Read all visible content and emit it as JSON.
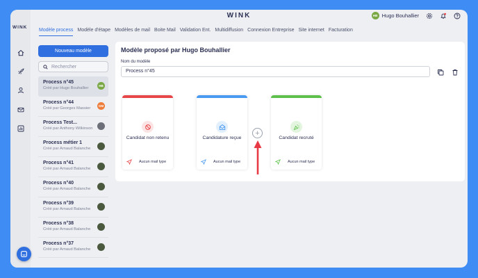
{
  "app": {
    "brand": "WINK",
    "rail_logo": "WINK"
  },
  "header": {
    "user_name": "Hugo Bouhallier",
    "user_initials": "HB",
    "icons": [
      "gear-icon",
      "bell-icon",
      "help-icon"
    ]
  },
  "tabs": [
    {
      "label": "Modèle process",
      "active": true
    },
    {
      "label": "Modèle d'étape"
    },
    {
      "label": "Modèles de mail"
    },
    {
      "label": "Boite Mail"
    },
    {
      "label": "Validation Ent."
    },
    {
      "label": "Multidiffusion"
    },
    {
      "label": "Connexion Entreprise"
    },
    {
      "label": "Site internet"
    },
    {
      "label": "Facturation"
    }
  ],
  "sidebar": {
    "new_button": "Nouveau modèle",
    "search_placeholder": "Rechercher",
    "items": [
      {
        "title": "Process n°45",
        "subtitle": "Créé par Hugo Bouhallier",
        "initials": "HB",
        "color": "#7aa844"
      },
      {
        "title": "Process n°44",
        "subtitle": "Créé par Georges Massier",
        "initials": "GM",
        "color": "#ee7d3b"
      },
      {
        "title": "Process Test...",
        "subtitle": "Créé par Anthony Wilkinson",
        "initials": "",
        "color": "#6c6f78"
      },
      {
        "title": "Process métier 1",
        "subtitle": "Créé par Arnaud Balanche",
        "initials": "",
        "color": "#4b5a3f"
      },
      {
        "title": "Process n°41",
        "subtitle": "Créé par Arnaud Balanche",
        "initials": "",
        "color": "#4b5a3f"
      },
      {
        "title": "Process n°40",
        "subtitle": "Créé par Arnaud Balanche",
        "initials": "",
        "color": "#4b5a3f"
      },
      {
        "title": "Process n°39",
        "subtitle": "Créé par Arnaud Balanche",
        "initials": "",
        "color": "#4b5a3f"
      },
      {
        "title": "Process n°38",
        "subtitle": "Créé par Arnaud Balanche",
        "initials": "",
        "color": "#4b5a3f"
      },
      {
        "title": "Process n°37",
        "subtitle": "Créé par Arnaud Balanche",
        "initials": "",
        "color": "#4b5a3f"
      }
    ]
  },
  "main": {
    "title": "Modèle proposé par Hugo Bouhallier",
    "name_label": "Nom du modèle",
    "name_value": "Process n°45",
    "cards": [
      {
        "label": "Candidat non retenu",
        "color": "#e8474a",
        "icon": "ban-icon",
        "foot": "Aucun mail type"
      },
      {
        "label": "Candidature reçue",
        "color": "#4b9af2",
        "icon": "mail-open-icon",
        "foot": "Aucun mail type"
      },
      {
        "label": "Candidat recruté",
        "color": "#5cc04a",
        "icon": "party-icon",
        "foot": "Aucun mail type"
      }
    ]
  },
  "colors": {
    "accent": "#2f6fdf",
    "arrow": "#e83a45",
    "background": "#3f8df4"
  }
}
